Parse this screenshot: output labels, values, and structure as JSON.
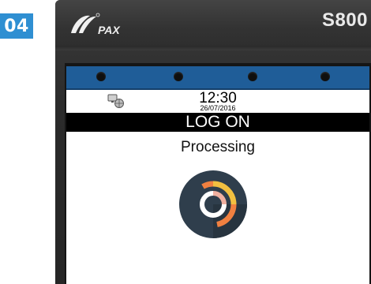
{
  "step": {
    "number": "04",
    "color": "#2f8fd2"
  },
  "device": {
    "brand_logo": "PAX",
    "model": "S800"
  },
  "screen": {
    "led_bar_color": "#1f5d98",
    "status": {
      "network_icon": "network-icon",
      "time": "12:30",
      "date": "26/07/2016"
    },
    "title": "LOG ON",
    "message": "Processing",
    "spinner_icon": "loading-spinner-icon",
    "spinner_colors": {
      "disc": "#2f3e4c",
      "arc_orange": "#f08040",
      "arc_yellow": "#f2c040",
      "arc_inner": "#f0b0a0"
    }
  }
}
